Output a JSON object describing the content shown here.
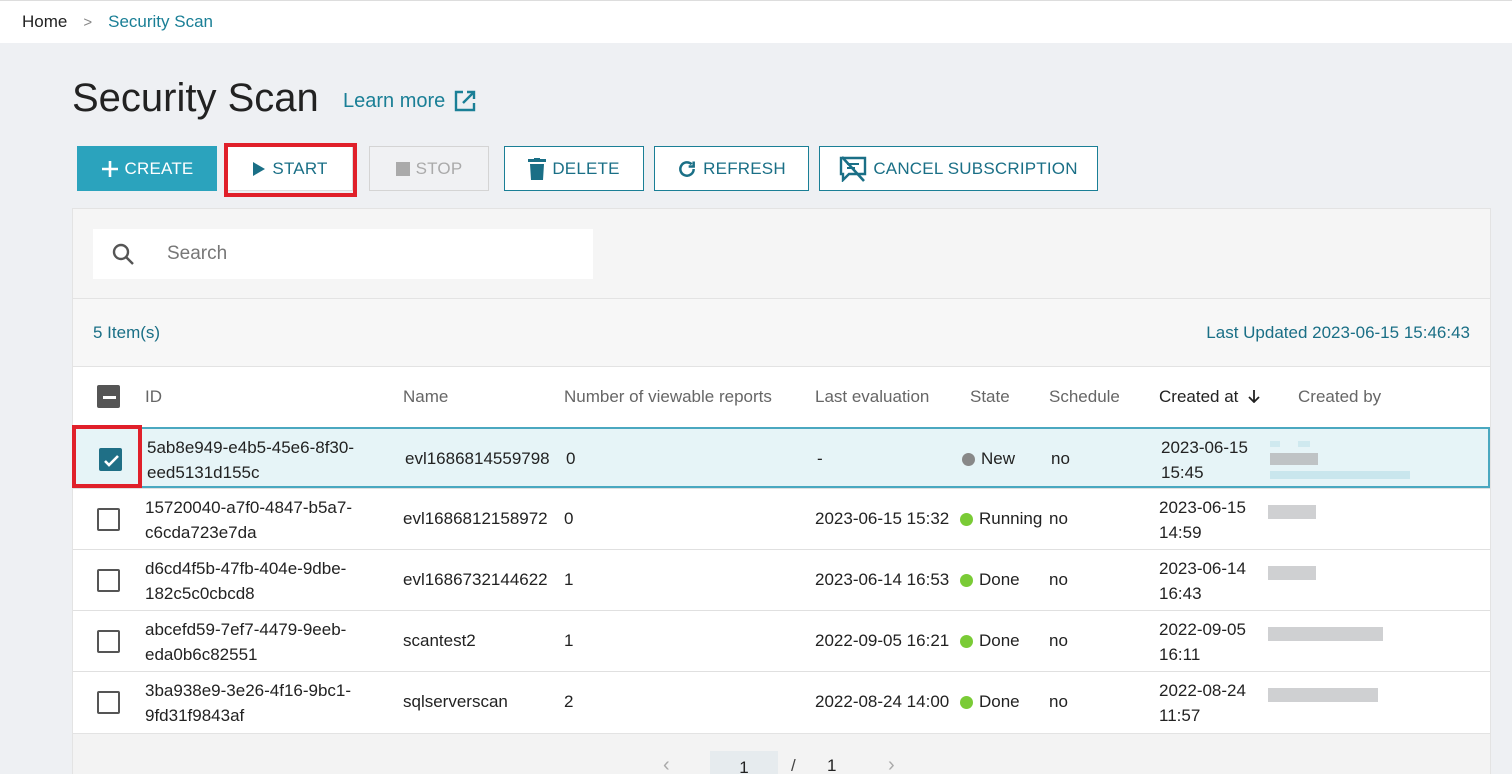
{
  "breadcrumb": {
    "home": "Home",
    "separator": ">",
    "current": "Security Scan"
  },
  "page": {
    "title": "Security Scan",
    "learn_more": "Learn more"
  },
  "toolbar": {
    "create": "CREATE",
    "start": "START",
    "stop": "STOP",
    "delete": "DELETE",
    "refresh": "REFRESH",
    "cancel_subscription": "CANCEL SUBSCRIPTION"
  },
  "search": {
    "placeholder": "Search"
  },
  "summary": {
    "item_count": "5 Item(s)",
    "last_updated": "Last Updated 2023-06-15 15:46:43"
  },
  "columns": {
    "id": "ID",
    "name": "Name",
    "reports": "Number of viewable reports",
    "last_evaluation": "Last evaluation",
    "state": "State",
    "schedule": "Schedule",
    "created_at": "Created at",
    "created_by": "Created by"
  },
  "rows": [
    {
      "id_1": "5ab8e949-e4b5-45e6-8f30-",
      "id_2": "eed5131d155c",
      "name": "evl1686814559798",
      "reports": "0",
      "last_evaluation": "-",
      "state": "New",
      "schedule": "no",
      "created_date": "2023-06-15",
      "created_time": "15:45",
      "checked": true
    },
    {
      "id_1": "15720040-a7f0-4847-b5a7-",
      "id_2": "c6cda723e7da",
      "name": "evl1686812158972",
      "reports": "0",
      "last_evaluation": "2023-06-15 15:32",
      "state": "Running",
      "schedule": "no",
      "created_date": "2023-06-15",
      "created_time": "14:59",
      "checked": false
    },
    {
      "id_1": "d6cd4f5b-47fb-404e-9dbe-",
      "id_2": "182c5c0cbcd8",
      "name": "evl1686732144622",
      "reports": "1",
      "last_evaluation": "2023-06-14 16:53",
      "state": "Done",
      "schedule": "no",
      "created_date": "2023-06-14",
      "created_time": "16:43",
      "checked": false
    },
    {
      "id_1": "abcefd59-7ef7-4479-9eeb-",
      "id_2": "eda0b6c82551",
      "name": "scantest2",
      "reports": "1",
      "last_evaluation": "2022-09-05 16:21",
      "state": "Done",
      "schedule": "no",
      "created_date": "2022-09-05",
      "created_time": "16:11",
      "checked": false
    },
    {
      "id_1": "3ba938e9-3e26-4f16-9bc1-",
      "id_2": "9fd31f9843af",
      "name": "sqlserverscan",
      "reports": "2",
      "last_evaluation": "2022-08-24 14:00",
      "state": "Done",
      "schedule": "no",
      "created_date": "2022-08-24",
      "created_time": "11:57",
      "checked": false
    }
  ],
  "pagination": {
    "prev": "‹",
    "current": "1",
    "separator": "/",
    "total": "1",
    "next": "›"
  },
  "colors": {
    "accent": "#2ba3bd",
    "link": "#1a7f96",
    "highlight": "#e0202a",
    "state_done": "#7acb36",
    "state_new": "#888888"
  }
}
